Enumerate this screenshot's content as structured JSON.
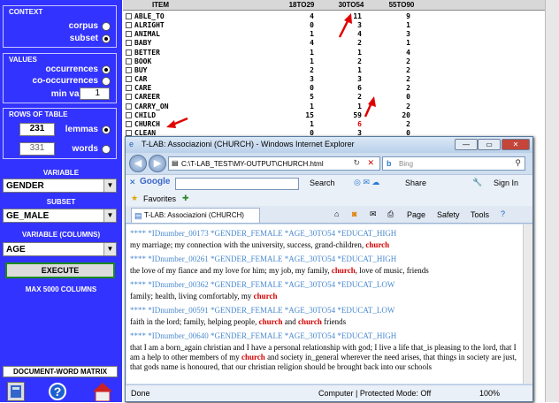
{
  "left_panel": {
    "context": {
      "title": "CONTEXT",
      "options": [
        "corpus",
        "subset"
      ],
      "selected": "subset"
    },
    "values": {
      "title": "VALUES",
      "options": [
        "occurrences",
        "co-occurrences"
      ],
      "selected": "occurrences",
      "min_label": "min val.",
      "min_value": "1"
    },
    "rows": {
      "title": "ROWS OF TABLE",
      "lemmas_value": "231",
      "lemmas_label": "lemmas",
      "words_value": "331",
      "words_label": "words",
      "selected": "lemmas"
    },
    "variable_label": "VARIABLE",
    "variable_value": "GENDER",
    "subset_label": "SUBSET",
    "subset_value": "GE_MALE",
    "varcol_label": "VARIABLE (COLUMNS)",
    "varcol_value": "AGE",
    "execute_label": "EXECUTE",
    "max_cols": "MAX 5000 COLUMNS",
    "dwm_label": "DOCUMENT-WORD MATRIX"
  },
  "table": {
    "headers": [
      "ITEM",
      "18TO29",
      "30TO54",
      "55TO90"
    ],
    "rows": [
      [
        "ABLE_TO",
        "4",
        "11",
        "9"
      ],
      [
        "ALRIGHT",
        "0",
        "3",
        "1"
      ],
      [
        "ANIMAL",
        "1",
        "4",
        "3"
      ],
      [
        "BABY",
        "4",
        "2",
        "1"
      ],
      [
        "BETTER",
        "1",
        "1",
        "4"
      ],
      [
        "BOOK",
        "1",
        "2",
        "2"
      ],
      [
        "BUY",
        "2",
        "1",
        "2"
      ],
      [
        "CAR",
        "3",
        "3",
        "2"
      ],
      [
        "CARE",
        "0",
        "6",
        "2"
      ],
      [
        "CAREER",
        "5",
        "2",
        "0"
      ],
      [
        "CARRY_ON",
        "1",
        "1",
        "2"
      ],
      [
        "CHILD",
        "15",
        "59",
        "20"
      ],
      [
        "CHURCH",
        "1",
        "6",
        "2"
      ],
      [
        "CLEAN",
        "0",
        "3",
        "0"
      ]
    ],
    "highlight_row": 12,
    "highlight_color": "#e00000"
  },
  "ie": {
    "title": "T-LAB: Associazioni (CHURCH) - Windows Internet Explorer",
    "address": "C:\\T-LAB_TEST\\MY-OUTPUT\\CHURCH.html",
    "search_placeholder": "Bing",
    "google_label": "Google",
    "search_btn": "Search",
    "share_btn": "Share",
    "signin_btn": "Sign In",
    "favorites": "Favorites",
    "tab_title": "T-LAB: Associazioni (CHURCH)",
    "page_menu": "Page",
    "safety_menu": "Safety",
    "tools_menu": "Tools",
    "status_done": "Done",
    "status_zone": "Computer | Protected Mode: Off",
    "zoom": "100%",
    "records": [
      {
        "header": "**** *IDnumber_00173 *GENDER_FEMALE *AGE_30TO54 *EDUCAT_HIGH",
        "pre": "my marriage; my connection with the university, success, grand-children, ",
        "hl": "church",
        "post": ""
      },
      {
        "header": "**** *IDnumber_00261 *GENDER_FEMALE *AGE_30TO54 *EDUCAT_HIGH",
        "pre": "the love of my fiance and my love for him; my job, my family, ",
        "hl": "church",
        "post": ", love of music, friends"
      },
      {
        "header": "**** *IDnumber_00362 *GENDER_FEMALE *AGE_30TO54 *EDUCAT_LOW",
        "pre": "family; health, living comfortably, my ",
        "hl": "church",
        "post": ""
      },
      {
        "header": "**** *IDnumber_00591 *GENDER_FEMALE *AGE_30TO54 *EDUCAT_LOW",
        "pre": "faith in the lord; family, helping people, ",
        "hl": "church",
        "mid": " and ",
        "hl2": "church",
        "post": " friends"
      },
      {
        "header": "**** *IDnumber_00640 *GENDER_FEMALE *AGE_30TO54 *EDUCAT_HIGH",
        "pre": "that I am a born_again christian and I have a personal relationship with god; I live a life that_is pleasing to the lord, that I am a help to other members of my ",
        "hl": "church",
        "mid": " and society in_general wherever the need arises, that things in society are just, that gods name is honoured, that our christian religion should be brought back into our schools",
        "post": ""
      }
    ]
  }
}
